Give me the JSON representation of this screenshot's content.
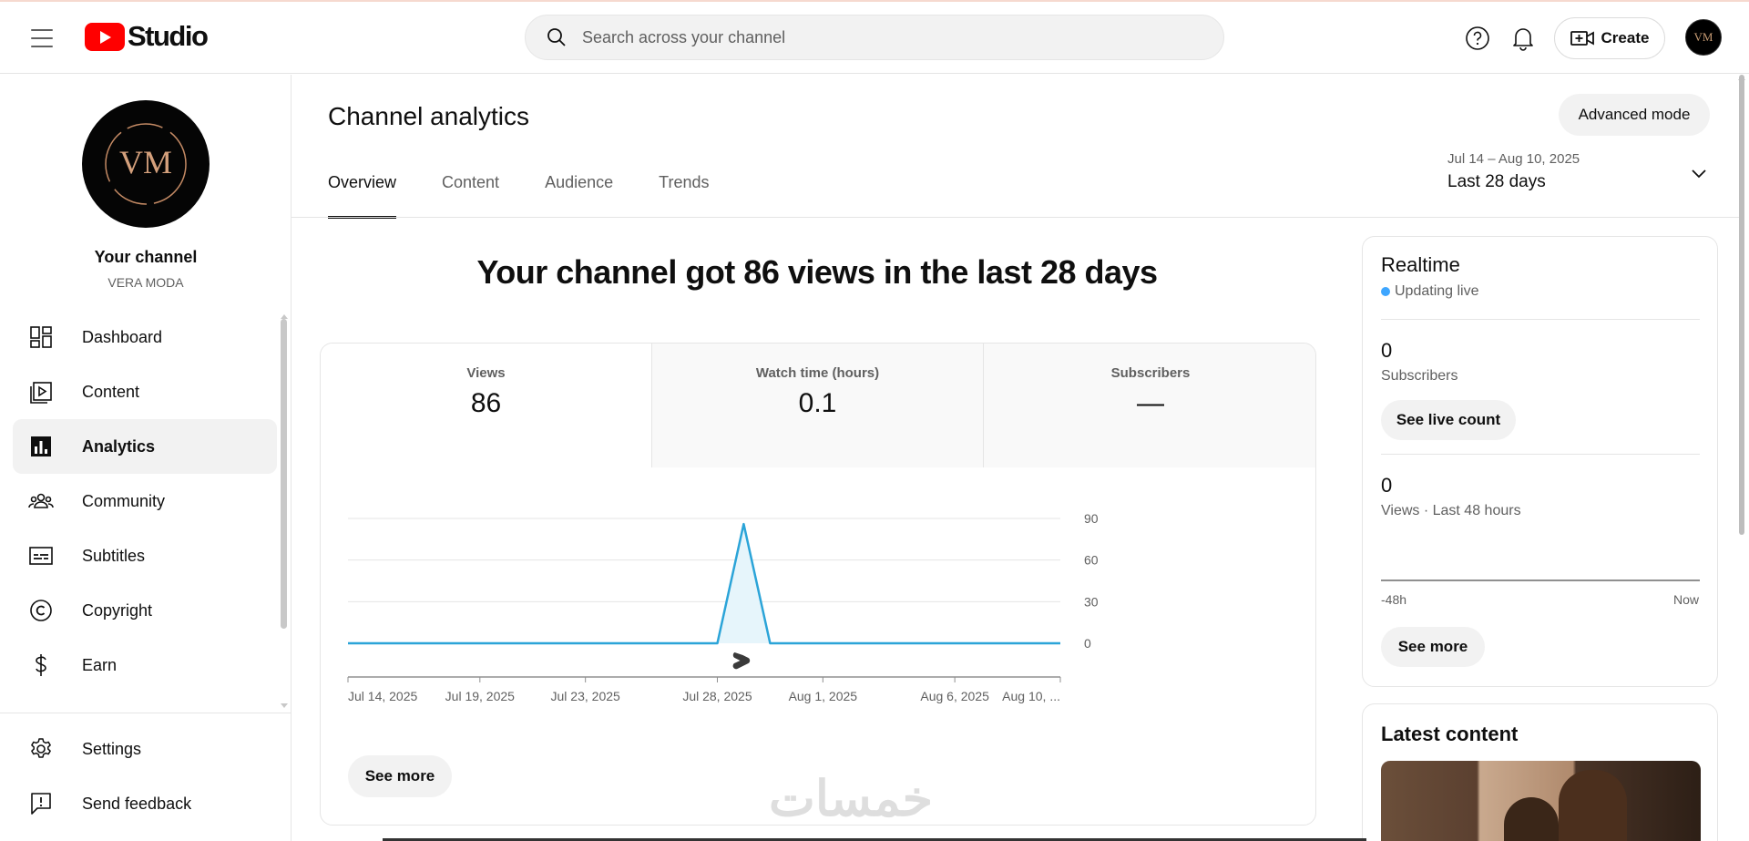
{
  "header": {
    "logo_text": "Studio",
    "search_placeholder": "Search across your channel",
    "create_label": "Create",
    "avatar_initials": "VM"
  },
  "sidebar": {
    "channel_name": "Your channel",
    "channel_handle": "VERA MODA",
    "avatar_initials": "VM",
    "items": [
      {
        "label": "Dashboard",
        "icon": "dashboard-icon"
      },
      {
        "label": "Content",
        "icon": "content-icon"
      },
      {
        "label": "Analytics",
        "icon": "analytics-icon",
        "active": true
      },
      {
        "label": "Community",
        "icon": "community-icon"
      },
      {
        "label": "Subtitles",
        "icon": "subtitles-icon"
      },
      {
        "label": "Copyright",
        "icon": "copyright-icon"
      },
      {
        "label": "Earn",
        "icon": "earn-icon"
      }
    ],
    "bottom_items": [
      {
        "label": "Settings",
        "icon": "gear-icon"
      },
      {
        "label": "Send feedback",
        "icon": "feedback-icon"
      }
    ]
  },
  "main": {
    "title": "Channel analytics",
    "advanced_mode_label": "Advanced mode",
    "date_range": "Jul 14 – Aug 10, 2025",
    "date_label": "Last 28 days",
    "tabs": [
      {
        "label": "Overview",
        "active": true
      },
      {
        "label": "Content"
      },
      {
        "label": "Audience"
      },
      {
        "label": "Trends"
      }
    ],
    "headline": "Your channel got 86 views in the last 28 days",
    "metrics": [
      {
        "label": "Views",
        "value": "86",
        "selected": true
      },
      {
        "label": "Watch time (hours)",
        "value": "0.1"
      },
      {
        "label": "Subscribers",
        "value": "—"
      }
    ],
    "see_more_label": "See more",
    "watermark": "خمسات"
  },
  "chart_data": {
    "type": "area",
    "x": [
      "Jul 14, 2025",
      "Jul 15, 2025",
      "Jul 16, 2025",
      "Jul 17, 2025",
      "Jul 18, 2025",
      "Jul 19, 2025",
      "Jul 20, 2025",
      "Jul 21, 2025",
      "Jul 22, 2025",
      "Jul 23, 2025",
      "Jul 24, 2025",
      "Jul 25, 2025",
      "Jul 26, 2025",
      "Jul 27, 2025",
      "Jul 28, 2025",
      "Jul 29, 2025",
      "Jul 30, 2025",
      "Jul 31, 2025",
      "Aug 1, 2025",
      "Aug 2, 2025",
      "Aug 3, 2025",
      "Aug 4, 2025",
      "Aug 5, 2025",
      "Aug 6, 2025",
      "Aug 7, 2025",
      "Aug 8, 2025",
      "Aug 9, 2025",
      "Aug 10, 2025"
    ],
    "series": [
      {
        "values": [
          0,
          0,
          0,
          0,
          0,
          0,
          0,
          0,
          0,
          0,
          0,
          0,
          0,
          0,
          0,
          86,
          0,
          0,
          0,
          0,
          0,
          0,
          0,
          0,
          0,
          0,
          0,
          0
        ]
      }
    ],
    "x_tick_labels": [
      "Jul 14, 2025",
      "Jul 19, 2025",
      "Jul 23, 2025",
      "Jul 28, 2025",
      "Aug 1, 2025",
      "Aug 6, 2025",
      "Aug 10, ..."
    ],
    "y_ticks": [
      "0",
      "30",
      "60",
      "90"
    ],
    "ylim": [
      0,
      90
    ],
    "grid": true,
    "color": "#2ba4d8",
    "fill_color": "#e6f5fb",
    "annotation_icon": "shorts-icon"
  },
  "realtime": {
    "title": "Realtime",
    "status": "Updating live",
    "subscribers_value": "0",
    "subscribers_label": "Subscribers",
    "live_count_label": "See live count",
    "views_value": "0",
    "views_label": "Views · Last 48 hours",
    "axis_start": "-48h",
    "axis_end": "Now",
    "see_more_label": "See more"
  },
  "latest_content": {
    "title": "Latest content"
  }
}
